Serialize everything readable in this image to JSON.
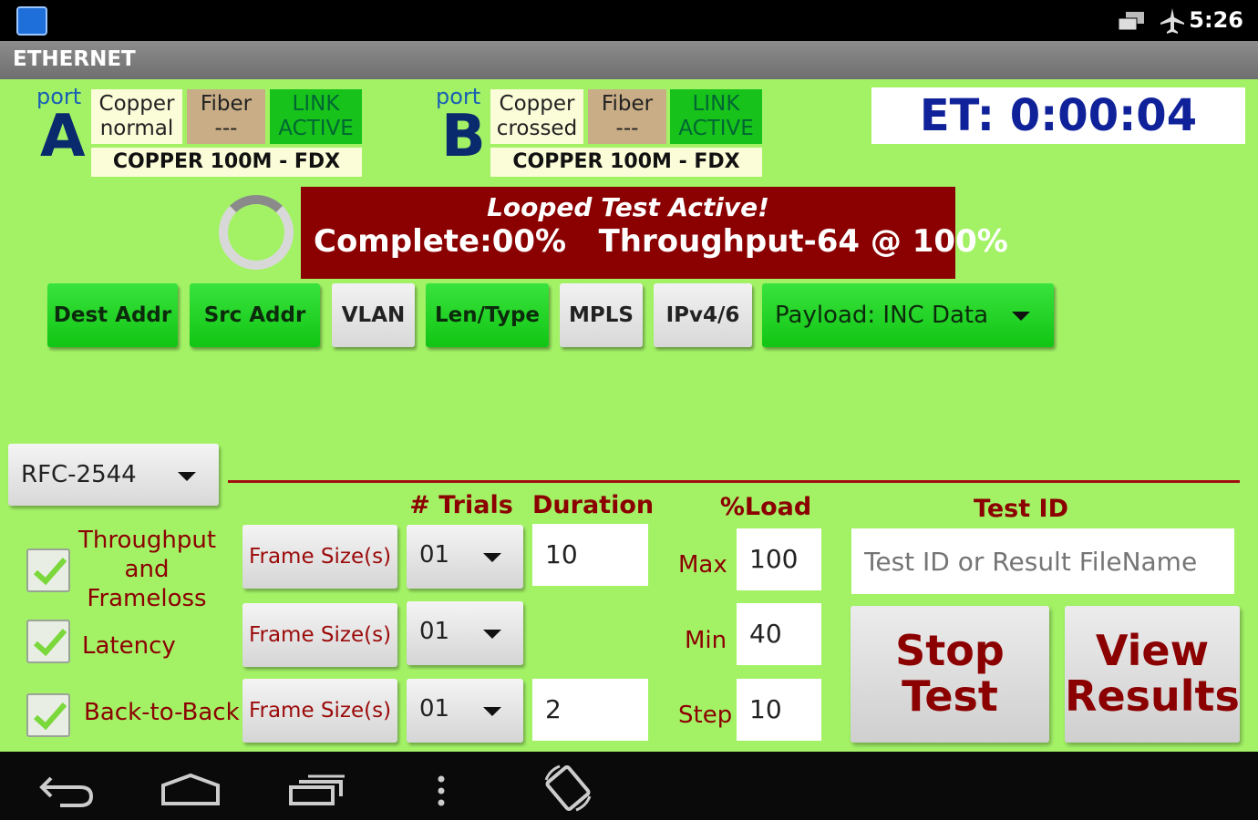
{
  "status_bar": {
    "time": "5:26"
  },
  "app": {
    "title": "ETHERNET"
  },
  "port_a": {
    "label": "port",
    "letter": "A",
    "copper_line1": "Copper",
    "copper_line2": "normal",
    "fiber_line1": "Fiber",
    "fiber_line2": "---",
    "link_line1": "LINK",
    "link_line2": "ACTIVE",
    "speed": "COPPER 100M  - FDX"
  },
  "port_b": {
    "label": "port",
    "letter": "B",
    "copper_line1": "Copper",
    "copper_line2": "crossed",
    "fiber_line1": "Fiber",
    "fiber_line2": "---",
    "link_line1": "LINK",
    "link_line2": "ACTIVE",
    "speed": "COPPER 100M  - FDX"
  },
  "elapsed": "ET: 0:00:04",
  "banner": {
    "line1": "Looped Test Active!",
    "line2": "Complete:00%   Throughput-64 @ 100%"
  },
  "toolbar": {
    "dest_addr": "Dest Addr",
    "src_addr": "Src Addr",
    "vlan": "VLAN",
    "len_type": "Len/Type",
    "mpls": "MPLS",
    "ipv46": "IPv4/6",
    "payload": "Payload: INC Data"
  },
  "test_select": {
    "value": "RFC-2544"
  },
  "headers": {
    "trials": "# Trials",
    "duration": "Duration",
    "load": "%Load",
    "test_id": "Test ID"
  },
  "tests": [
    {
      "name_line1": "Throughput",
      "name_line2": "and",
      "name_line3": "Frameloss",
      "checked": true,
      "frame_btn": "Frame Size(s)",
      "trials": "01",
      "duration": "10"
    },
    {
      "name_line1": "Latency",
      "checked": true,
      "frame_btn": "Frame Size(s)",
      "trials": "01"
    },
    {
      "name_line1": "Back-to-Back",
      "checked": true,
      "frame_btn": "Frame Size(s)",
      "trials": "01",
      "duration": "2"
    }
  ],
  "load": {
    "max_label": "Max",
    "max": "100",
    "min_label": "Min",
    "min": "40",
    "step_label": "Step",
    "step": "10"
  },
  "test_id": {
    "placeholder": "Test ID or Result FileName"
  },
  "actions": {
    "stop_line1": "Stop",
    "stop_line2": "Test",
    "view_line1": "View",
    "view_line2": "Results"
  },
  "colors": {
    "background": "#a3f266",
    "banner": "#8b0000",
    "link_active": "#17c21b",
    "label_red": "#8b0000"
  }
}
